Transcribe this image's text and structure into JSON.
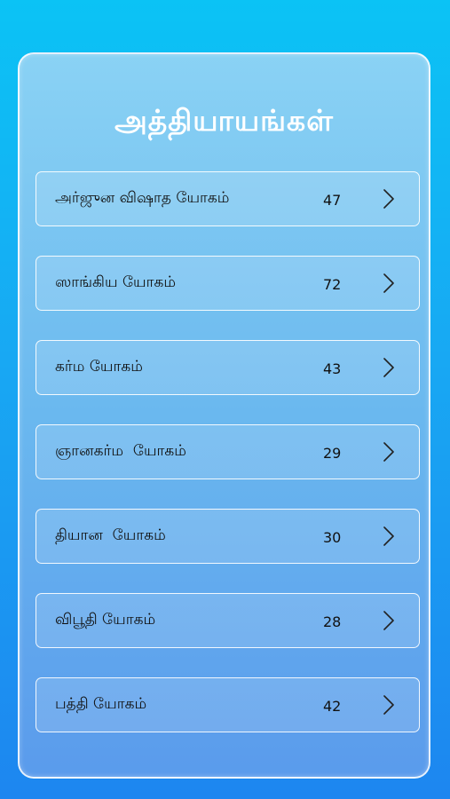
{
  "screen": {
    "title": "அத்தியாயங்கள்"
  },
  "chapters": [
    {
      "name": "அர்ஜுன விஷாத யோகம்",
      "verses": "47"
    },
    {
      "name": "ஸாங்கிய யோகம்",
      "verses": "72"
    },
    {
      "name": "கர்ம யோகம்",
      "verses": "43"
    },
    {
      "name": "ஞானகர்ம  யோகம்",
      "verses": "29"
    },
    {
      "name": "தியான  யோகம்",
      "verses": "30"
    },
    {
      "name": "விபூதி யோகம்",
      "verses": "28"
    },
    {
      "name": "பத்தி யோகம்",
      "verses": "42"
    }
  ],
  "icons": {
    "row_arrow": "chevron-right-icon"
  },
  "colors": {
    "background_top": "#0bc3f5",
    "background_bottom": "#1d86f0",
    "panel": "#7cc4f2",
    "text": "#111111",
    "title": "#ffffff"
  }
}
